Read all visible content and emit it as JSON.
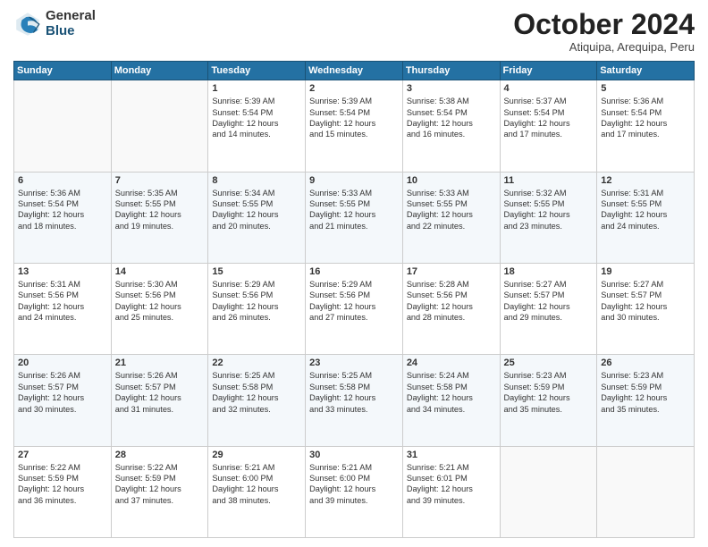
{
  "logo": {
    "general": "General",
    "blue": "Blue"
  },
  "header": {
    "month": "October 2024",
    "location": "Atiquipa, Arequipa, Peru"
  },
  "weekdays": [
    "Sunday",
    "Monday",
    "Tuesday",
    "Wednesday",
    "Thursday",
    "Friday",
    "Saturday"
  ],
  "weeks": [
    [
      {
        "day": "",
        "content": ""
      },
      {
        "day": "",
        "content": ""
      },
      {
        "day": "1",
        "content": "Sunrise: 5:39 AM\nSunset: 5:54 PM\nDaylight: 12 hours\nand 14 minutes."
      },
      {
        "day": "2",
        "content": "Sunrise: 5:39 AM\nSunset: 5:54 PM\nDaylight: 12 hours\nand 15 minutes."
      },
      {
        "day": "3",
        "content": "Sunrise: 5:38 AM\nSunset: 5:54 PM\nDaylight: 12 hours\nand 16 minutes."
      },
      {
        "day": "4",
        "content": "Sunrise: 5:37 AM\nSunset: 5:54 PM\nDaylight: 12 hours\nand 17 minutes."
      },
      {
        "day": "5",
        "content": "Sunrise: 5:36 AM\nSunset: 5:54 PM\nDaylight: 12 hours\nand 17 minutes."
      }
    ],
    [
      {
        "day": "6",
        "content": "Sunrise: 5:36 AM\nSunset: 5:54 PM\nDaylight: 12 hours\nand 18 minutes."
      },
      {
        "day": "7",
        "content": "Sunrise: 5:35 AM\nSunset: 5:55 PM\nDaylight: 12 hours\nand 19 minutes."
      },
      {
        "day": "8",
        "content": "Sunrise: 5:34 AM\nSunset: 5:55 PM\nDaylight: 12 hours\nand 20 minutes."
      },
      {
        "day": "9",
        "content": "Sunrise: 5:33 AM\nSunset: 5:55 PM\nDaylight: 12 hours\nand 21 minutes."
      },
      {
        "day": "10",
        "content": "Sunrise: 5:33 AM\nSunset: 5:55 PM\nDaylight: 12 hours\nand 22 minutes."
      },
      {
        "day": "11",
        "content": "Sunrise: 5:32 AM\nSunset: 5:55 PM\nDaylight: 12 hours\nand 23 minutes."
      },
      {
        "day": "12",
        "content": "Sunrise: 5:31 AM\nSunset: 5:55 PM\nDaylight: 12 hours\nand 24 minutes."
      }
    ],
    [
      {
        "day": "13",
        "content": "Sunrise: 5:31 AM\nSunset: 5:56 PM\nDaylight: 12 hours\nand 24 minutes."
      },
      {
        "day": "14",
        "content": "Sunrise: 5:30 AM\nSunset: 5:56 PM\nDaylight: 12 hours\nand 25 minutes."
      },
      {
        "day": "15",
        "content": "Sunrise: 5:29 AM\nSunset: 5:56 PM\nDaylight: 12 hours\nand 26 minutes."
      },
      {
        "day": "16",
        "content": "Sunrise: 5:29 AM\nSunset: 5:56 PM\nDaylight: 12 hours\nand 27 minutes."
      },
      {
        "day": "17",
        "content": "Sunrise: 5:28 AM\nSunset: 5:56 PM\nDaylight: 12 hours\nand 28 minutes."
      },
      {
        "day": "18",
        "content": "Sunrise: 5:27 AM\nSunset: 5:57 PM\nDaylight: 12 hours\nand 29 minutes."
      },
      {
        "day": "19",
        "content": "Sunrise: 5:27 AM\nSunset: 5:57 PM\nDaylight: 12 hours\nand 30 minutes."
      }
    ],
    [
      {
        "day": "20",
        "content": "Sunrise: 5:26 AM\nSunset: 5:57 PM\nDaylight: 12 hours\nand 30 minutes."
      },
      {
        "day": "21",
        "content": "Sunrise: 5:26 AM\nSunset: 5:57 PM\nDaylight: 12 hours\nand 31 minutes."
      },
      {
        "day": "22",
        "content": "Sunrise: 5:25 AM\nSunset: 5:58 PM\nDaylight: 12 hours\nand 32 minutes."
      },
      {
        "day": "23",
        "content": "Sunrise: 5:25 AM\nSunset: 5:58 PM\nDaylight: 12 hours\nand 33 minutes."
      },
      {
        "day": "24",
        "content": "Sunrise: 5:24 AM\nSunset: 5:58 PM\nDaylight: 12 hours\nand 34 minutes."
      },
      {
        "day": "25",
        "content": "Sunrise: 5:23 AM\nSunset: 5:59 PM\nDaylight: 12 hours\nand 35 minutes."
      },
      {
        "day": "26",
        "content": "Sunrise: 5:23 AM\nSunset: 5:59 PM\nDaylight: 12 hours\nand 35 minutes."
      }
    ],
    [
      {
        "day": "27",
        "content": "Sunrise: 5:22 AM\nSunset: 5:59 PM\nDaylight: 12 hours\nand 36 minutes."
      },
      {
        "day": "28",
        "content": "Sunrise: 5:22 AM\nSunset: 5:59 PM\nDaylight: 12 hours\nand 37 minutes."
      },
      {
        "day": "29",
        "content": "Sunrise: 5:21 AM\nSunset: 6:00 PM\nDaylight: 12 hours\nand 38 minutes."
      },
      {
        "day": "30",
        "content": "Sunrise: 5:21 AM\nSunset: 6:00 PM\nDaylight: 12 hours\nand 39 minutes."
      },
      {
        "day": "31",
        "content": "Sunrise: 5:21 AM\nSunset: 6:01 PM\nDaylight: 12 hours\nand 39 minutes."
      },
      {
        "day": "",
        "content": ""
      },
      {
        "day": "",
        "content": ""
      }
    ]
  ]
}
